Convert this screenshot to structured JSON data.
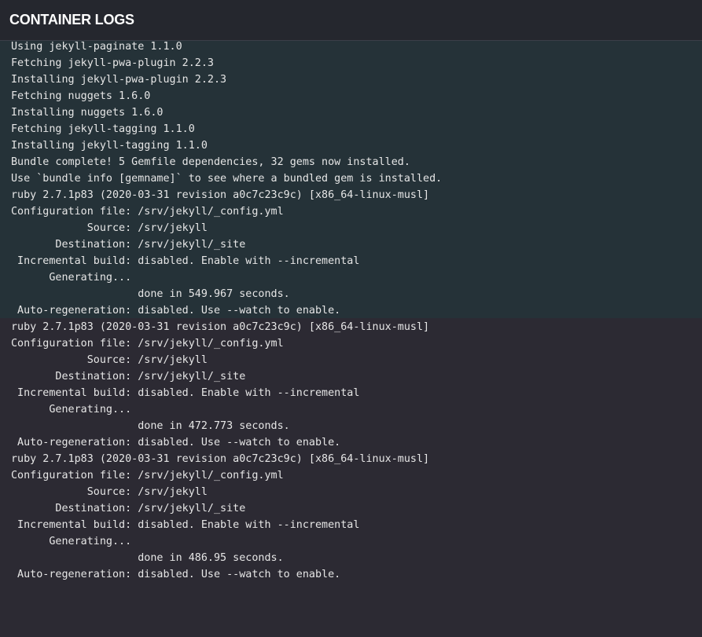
{
  "header": {
    "title": "CONTAINER LOGS"
  },
  "logs": [
    "Using jekyll-paginate 1.1.0",
    "Fetching jekyll-pwa-plugin 2.2.3",
    "Installing jekyll-pwa-plugin 2.2.3",
    "Fetching nuggets 1.6.0",
    "Installing nuggets 1.6.0",
    "Fetching jekyll-tagging 1.1.0",
    "Installing jekyll-tagging 1.1.0",
    "Bundle complete! 5 Gemfile dependencies, 32 gems now installed.",
    "Use `bundle info [gemname]` to see where a bundled gem is installed.",
    "ruby 2.7.1p83 (2020-03-31 revision a0c7c23c9c) [x86_64-linux-musl]",
    "Configuration file: /srv/jekyll/_config.yml",
    "            Source: /srv/jekyll",
    "       Destination: /srv/jekyll/_site",
    " Incremental build: disabled. Enable with --incremental",
    "      Generating...",
    "                    done in 549.967 seconds.",
    " Auto-regeneration: disabled. Use --watch to enable.",
    "ruby 2.7.1p83 (2020-03-31 revision a0c7c23c9c) [x86_64-linux-musl]",
    "Configuration file: /srv/jekyll/_config.yml",
    "            Source: /srv/jekyll",
    "       Destination: /srv/jekyll/_site",
    " Incremental build: disabled. Enable with --incremental",
    "      Generating...",
    "                    done in 472.773 seconds.",
    " Auto-regeneration: disabled. Use --watch to enable.",
    "ruby 2.7.1p83 (2020-03-31 revision a0c7c23c9c) [x86_64-linux-musl]",
    "Configuration file: /srv/jekyll/_config.yml",
    "            Source: /srv/jekyll",
    "       Destination: /srv/jekyll/_site",
    " Incremental build: disabled. Enable with --incremental",
    "      Generating...",
    "                    done in 486.95 seconds.",
    " Auto-regeneration: disabled. Use --watch to enable."
  ],
  "colors": {
    "header_bg": "#25272e",
    "log_bg": "#2c2a33",
    "highlight_bg": "#253238",
    "text": "#e6e6e6"
  }
}
